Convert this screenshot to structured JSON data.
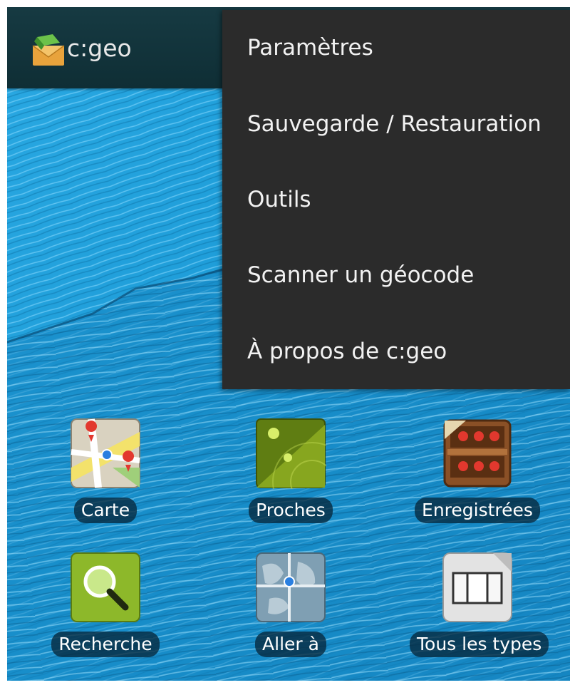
{
  "app": {
    "title": "c:geo",
    "logo_icon": "cgeo-logo-icon"
  },
  "menu": {
    "items": [
      {
        "label": "Paramètres"
      },
      {
        "label": "Sauvegarde / Restauration"
      },
      {
        "label": "Outils"
      },
      {
        "label": "Scanner un géocode"
      },
      {
        "label": "À propos de c:geo"
      }
    ]
  },
  "tiles": [
    {
      "label": "Carte",
      "icon": "map-icon"
    },
    {
      "label": "Proches",
      "icon": "radar-icon"
    },
    {
      "label": "Enregistrées",
      "icon": "stored-caches-icon"
    },
    {
      "label": "Recherche",
      "icon": "magnifier-icon"
    },
    {
      "label": "Aller à",
      "icon": "globe-goto-icon"
    },
    {
      "label": "Tous les types",
      "icon": "all-types-icon"
    }
  ],
  "colors": {
    "wallpaper": "#1c9bd6",
    "actionbar": "#133840",
    "menu_bg": "#2b2b2b",
    "label_bg": "#06283c"
  }
}
